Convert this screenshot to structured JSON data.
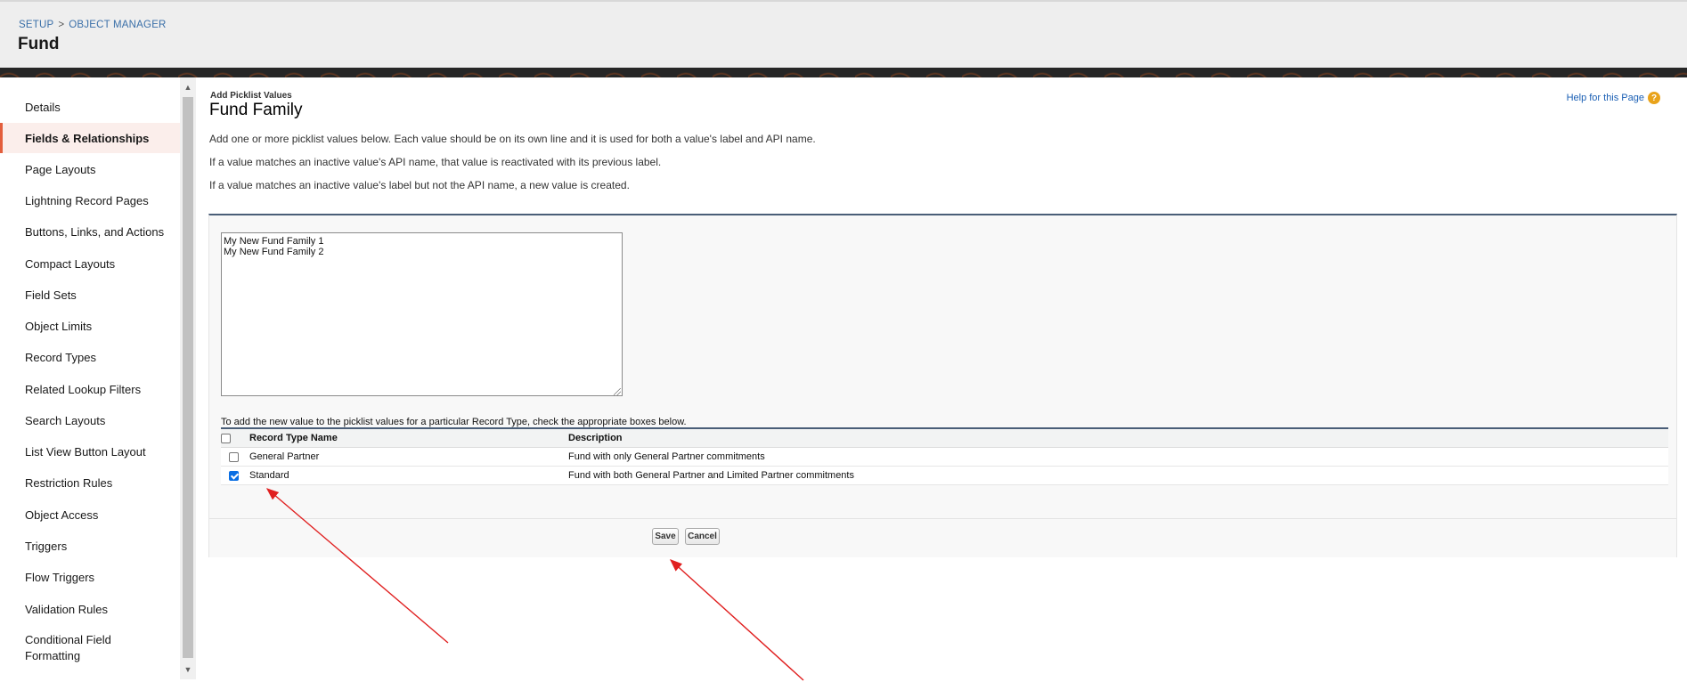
{
  "header": {
    "breadcrumb": {
      "setup": "SETUP",
      "separator": ">",
      "object_manager": "OBJECT MANAGER"
    },
    "title": "Fund"
  },
  "sidebar": {
    "items": [
      {
        "label": "Details"
      },
      {
        "label": "Fields & Relationships",
        "active": true
      },
      {
        "label": "Page Layouts"
      },
      {
        "label": "Lightning Record Pages"
      },
      {
        "label": "Buttons, Links, and Actions"
      },
      {
        "label": "Compact Layouts"
      },
      {
        "label": "Field Sets"
      },
      {
        "label": "Object Limits"
      },
      {
        "label": "Record Types"
      },
      {
        "label": "Related Lookup Filters"
      },
      {
        "label": "Search Layouts"
      },
      {
        "label": "List View Button Layout"
      },
      {
        "label": "Restriction Rules"
      },
      {
        "label": "Object Access"
      },
      {
        "label": "Triggers"
      },
      {
        "label": "Flow Triggers"
      },
      {
        "label": "Validation Rules"
      },
      {
        "label": "Conditional Field Formatting"
      }
    ]
  },
  "main": {
    "subtitle": "Add Picklist Values",
    "title": "Fund Family",
    "help_link": "Help for this Page",
    "help_icon": "question-icon",
    "instructions": [
      "Add one or more picklist values below. Each value should be on its own line and it is used for both a value's label and API name.",
      "If a value matches an inactive value's API name, that value is reactivated with its previous label.",
      "If a value matches an inactive value's label but not the API name, a new value is created."
    ],
    "textarea_value": "My New Fund Family 1\nMy New Fund Family 2",
    "record_type_instruction": "To add the new value to the picklist values for a particular Record Type, check the appropriate boxes below.",
    "table": {
      "headers": {
        "name": "Record Type Name",
        "description": "Description"
      },
      "rows": [
        {
          "name": "General Partner",
          "description": "Fund with only General Partner commitments",
          "checked": false
        },
        {
          "name": "Standard",
          "description": "Fund with both General Partner and Limited Partner commitments",
          "checked": true
        }
      ]
    },
    "buttons": {
      "save": "Save",
      "cancel": "Cancel"
    }
  },
  "colors": {
    "active_accent": "#e35e3c",
    "link": "#1a5fb4",
    "annotation_arrow": "#e02020",
    "checkbox_checked": "#0b6fe3"
  }
}
